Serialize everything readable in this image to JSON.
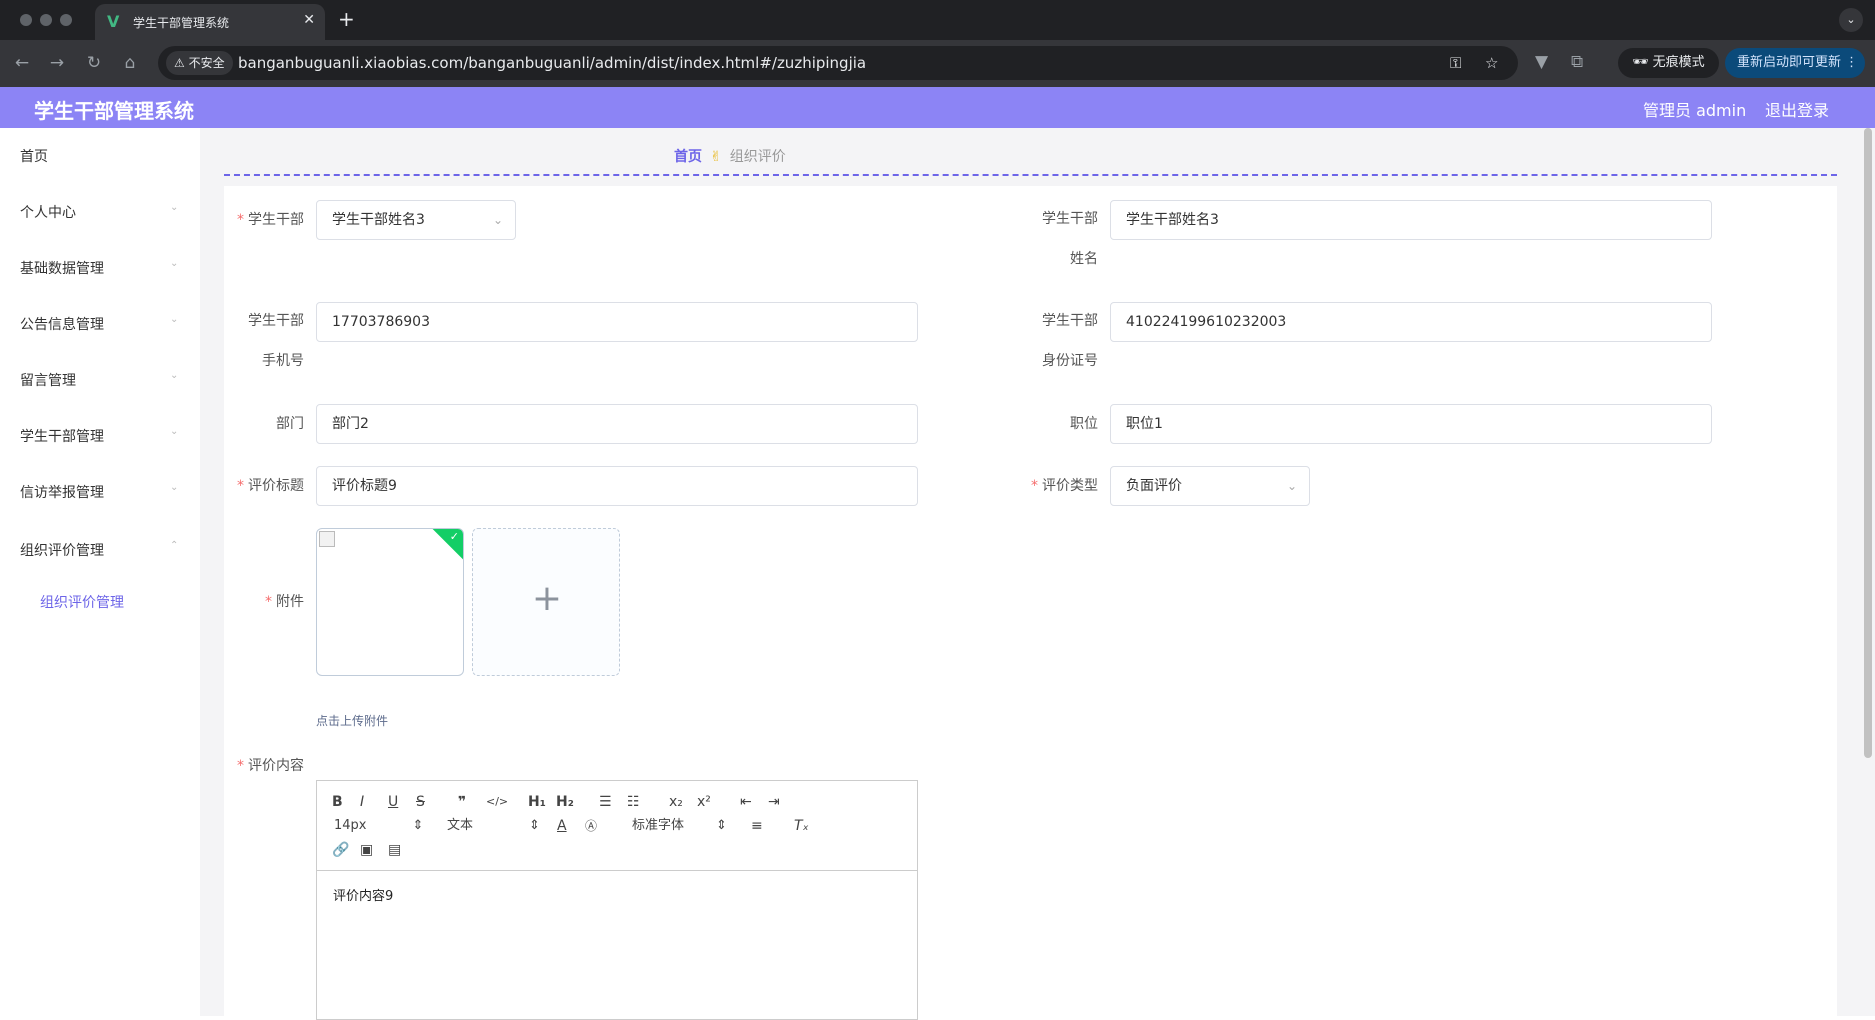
{
  "browser": {
    "tab_title": "学生干部管理系统",
    "tab_favicon": "V",
    "insecure_label": "不安全",
    "url": "banganbuguanli.xiaobias.com/banganbuguanli/admin/dist/index.html#/zuzhipingjia",
    "incognito_label": "无痕模式",
    "update_label": "重新启动即可更新"
  },
  "header": {
    "title": "学生干部管理系统",
    "user": "管理员 admin",
    "logout": "退出登录"
  },
  "sidebar": {
    "items": [
      {
        "label": "首页"
      },
      {
        "label": "个人中心"
      },
      {
        "label": "基础数据管理"
      },
      {
        "label": "公告信息管理"
      },
      {
        "label": "留言管理"
      },
      {
        "label": "学生干部管理"
      },
      {
        "label": "信访举报管理"
      },
      {
        "label": "组织评价管理"
      }
    ],
    "sub_item": "组织评价管理"
  },
  "breadcrumb": {
    "home": "首页",
    "current": "组织评价"
  },
  "form": {
    "cadre_label": "学生干部",
    "cadre_select": "学生干部姓名3",
    "name_label_1": "学生干部",
    "name_label_2": "姓名",
    "name_value": "学生干部姓名3",
    "phone_label_1": "学生干部",
    "phone_label_2": "手机号",
    "phone_value": "17703786903",
    "idcard_label_1": "学生干部",
    "idcard_label_2": "身份证号",
    "idcard_value": "410224199610232003",
    "dept_label": "部门",
    "dept_value": "部门2",
    "position_label": "职位",
    "position_value": "职位1",
    "title_label": "评价标题",
    "title_value": "评价标题9",
    "type_label": "评价类型",
    "type_value": "负面评价",
    "attach_label": "附件",
    "upload_tip": "点击上传附件",
    "content_label": "评价内容",
    "content_value": "评价内容9",
    "required_mark": "*"
  },
  "editor": {
    "font_size": "14px",
    "block_format": "文本",
    "font_family": "标准字体"
  }
}
